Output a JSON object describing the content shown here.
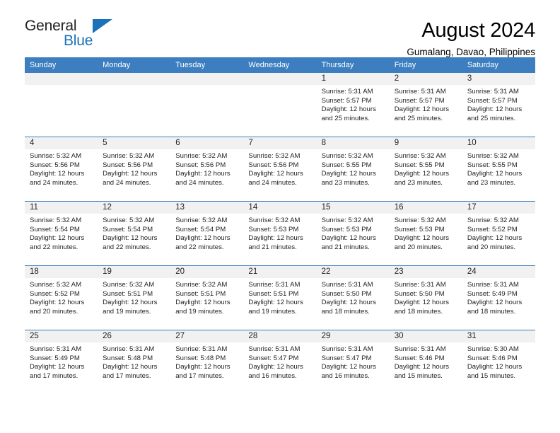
{
  "brand": {
    "word_one": "General",
    "word_two": "Blue",
    "triangle_icon": "triangle-icon"
  },
  "header": {
    "title": "August 2024",
    "subtitle": "Gumalang, Davao, Philippines"
  },
  "calendar": {
    "weekday_headers": [
      "Sunday",
      "Monday",
      "Tuesday",
      "Wednesday",
      "Thursday",
      "Friday",
      "Saturday"
    ],
    "accent_color": "#3c7ebf",
    "daynum_background": "#f1f1f1",
    "weeks": [
      [
        {
          "day": "",
          "empty": true
        },
        {
          "day": "",
          "empty": true
        },
        {
          "day": "",
          "empty": true
        },
        {
          "day": "",
          "empty": true
        },
        {
          "day": "1",
          "sunrise": "Sunrise: 5:31 AM",
          "sunset": "Sunset: 5:57 PM",
          "daylight_line1": "Daylight: 12 hours",
          "daylight_line2": "and 25 minutes."
        },
        {
          "day": "2",
          "sunrise": "Sunrise: 5:31 AM",
          "sunset": "Sunset: 5:57 PM",
          "daylight_line1": "Daylight: 12 hours",
          "daylight_line2": "and 25 minutes."
        },
        {
          "day": "3",
          "sunrise": "Sunrise: 5:31 AM",
          "sunset": "Sunset: 5:57 PM",
          "daylight_line1": "Daylight: 12 hours",
          "daylight_line2": "and 25 minutes."
        }
      ],
      [
        {
          "day": "4",
          "sunrise": "Sunrise: 5:32 AM",
          "sunset": "Sunset: 5:56 PM",
          "daylight_line1": "Daylight: 12 hours",
          "daylight_line2": "and 24 minutes."
        },
        {
          "day": "5",
          "sunrise": "Sunrise: 5:32 AM",
          "sunset": "Sunset: 5:56 PM",
          "daylight_line1": "Daylight: 12 hours",
          "daylight_line2": "and 24 minutes."
        },
        {
          "day": "6",
          "sunrise": "Sunrise: 5:32 AM",
          "sunset": "Sunset: 5:56 PM",
          "daylight_line1": "Daylight: 12 hours",
          "daylight_line2": "and 24 minutes."
        },
        {
          "day": "7",
          "sunrise": "Sunrise: 5:32 AM",
          "sunset": "Sunset: 5:56 PM",
          "daylight_line1": "Daylight: 12 hours",
          "daylight_line2": "and 24 minutes."
        },
        {
          "day": "8",
          "sunrise": "Sunrise: 5:32 AM",
          "sunset": "Sunset: 5:55 PM",
          "daylight_line1": "Daylight: 12 hours",
          "daylight_line2": "and 23 minutes."
        },
        {
          "day": "9",
          "sunrise": "Sunrise: 5:32 AM",
          "sunset": "Sunset: 5:55 PM",
          "daylight_line1": "Daylight: 12 hours",
          "daylight_line2": "and 23 minutes."
        },
        {
          "day": "10",
          "sunrise": "Sunrise: 5:32 AM",
          "sunset": "Sunset: 5:55 PM",
          "daylight_line1": "Daylight: 12 hours",
          "daylight_line2": "and 23 minutes."
        }
      ],
      [
        {
          "day": "11",
          "sunrise": "Sunrise: 5:32 AM",
          "sunset": "Sunset: 5:54 PM",
          "daylight_line1": "Daylight: 12 hours",
          "daylight_line2": "and 22 minutes."
        },
        {
          "day": "12",
          "sunrise": "Sunrise: 5:32 AM",
          "sunset": "Sunset: 5:54 PM",
          "daylight_line1": "Daylight: 12 hours",
          "daylight_line2": "and 22 minutes."
        },
        {
          "day": "13",
          "sunrise": "Sunrise: 5:32 AM",
          "sunset": "Sunset: 5:54 PM",
          "daylight_line1": "Daylight: 12 hours",
          "daylight_line2": "and 22 minutes."
        },
        {
          "day": "14",
          "sunrise": "Sunrise: 5:32 AM",
          "sunset": "Sunset: 5:53 PM",
          "daylight_line1": "Daylight: 12 hours",
          "daylight_line2": "and 21 minutes."
        },
        {
          "day": "15",
          "sunrise": "Sunrise: 5:32 AM",
          "sunset": "Sunset: 5:53 PM",
          "daylight_line1": "Daylight: 12 hours",
          "daylight_line2": "and 21 minutes."
        },
        {
          "day": "16",
          "sunrise": "Sunrise: 5:32 AM",
          "sunset": "Sunset: 5:53 PM",
          "daylight_line1": "Daylight: 12 hours",
          "daylight_line2": "and 20 minutes."
        },
        {
          "day": "17",
          "sunrise": "Sunrise: 5:32 AM",
          "sunset": "Sunset: 5:52 PM",
          "daylight_line1": "Daylight: 12 hours",
          "daylight_line2": "and 20 minutes."
        }
      ],
      [
        {
          "day": "18",
          "sunrise": "Sunrise: 5:32 AM",
          "sunset": "Sunset: 5:52 PM",
          "daylight_line1": "Daylight: 12 hours",
          "daylight_line2": "and 20 minutes."
        },
        {
          "day": "19",
          "sunrise": "Sunrise: 5:32 AM",
          "sunset": "Sunset: 5:51 PM",
          "daylight_line1": "Daylight: 12 hours",
          "daylight_line2": "and 19 minutes."
        },
        {
          "day": "20",
          "sunrise": "Sunrise: 5:32 AM",
          "sunset": "Sunset: 5:51 PM",
          "daylight_line1": "Daylight: 12 hours",
          "daylight_line2": "and 19 minutes."
        },
        {
          "day": "21",
          "sunrise": "Sunrise: 5:31 AM",
          "sunset": "Sunset: 5:51 PM",
          "daylight_line1": "Daylight: 12 hours",
          "daylight_line2": "and 19 minutes."
        },
        {
          "day": "22",
          "sunrise": "Sunrise: 5:31 AM",
          "sunset": "Sunset: 5:50 PM",
          "daylight_line1": "Daylight: 12 hours",
          "daylight_line2": "and 18 minutes."
        },
        {
          "day": "23",
          "sunrise": "Sunrise: 5:31 AM",
          "sunset": "Sunset: 5:50 PM",
          "daylight_line1": "Daylight: 12 hours",
          "daylight_line2": "and 18 minutes."
        },
        {
          "day": "24",
          "sunrise": "Sunrise: 5:31 AM",
          "sunset": "Sunset: 5:49 PM",
          "daylight_line1": "Daylight: 12 hours",
          "daylight_line2": "and 18 minutes."
        }
      ],
      [
        {
          "day": "25",
          "sunrise": "Sunrise: 5:31 AM",
          "sunset": "Sunset: 5:49 PM",
          "daylight_line1": "Daylight: 12 hours",
          "daylight_line2": "and 17 minutes."
        },
        {
          "day": "26",
          "sunrise": "Sunrise: 5:31 AM",
          "sunset": "Sunset: 5:48 PM",
          "daylight_line1": "Daylight: 12 hours",
          "daylight_line2": "and 17 minutes."
        },
        {
          "day": "27",
          "sunrise": "Sunrise: 5:31 AM",
          "sunset": "Sunset: 5:48 PM",
          "daylight_line1": "Daylight: 12 hours",
          "daylight_line2": "and 17 minutes."
        },
        {
          "day": "28",
          "sunrise": "Sunrise: 5:31 AM",
          "sunset": "Sunset: 5:47 PM",
          "daylight_line1": "Daylight: 12 hours",
          "daylight_line2": "and 16 minutes."
        },
        {
          "day": "29",
          "sunrise": "Sunrise: 5:31 AM",
          "sunset": "Sunset: 5:47 PM",
          "daylight_line1": "Daylight: 12 hours",
          "daylight_line2": "and 16 minutes."
        },
        {
          "day": "30",
          "sunrise": "Sunrise: 5:31 AM",
          "sunset": "Sunset: 5:46 PM",
          "daylight_line1": "Daylight: 12 hours",
          "daylight_line2": "and 15 minutes."
        },
        {
          "day": "31",
          "sunrise": "Sunrise: 5:30 AM",
          "sunset": "Sunset: 5:46 PM",
          "daylight_line1": "Daylight: 12 hours",
          "daylight_line2": "and 15 minutes."
        }
      ]
    ]
  }
}
